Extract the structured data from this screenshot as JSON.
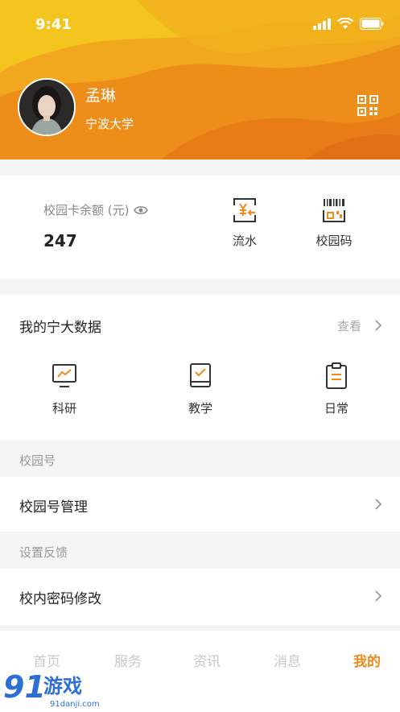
{
  "status": {
    "time": "9:41"
  },
  "profile": {
    "name": "孟琳",
    "school": "宁波大学"
  },
  "card": {
    "balance_label": "校园卡余额 (元)",
    "balance_value": "247",
    "actions": [
      {
        "label": "流水",
        "icon": "yen-transfer-icon"
      },
      {
        "label": "校园码",
        "icon": "barcode-icon"
      }
    ]
  },
  "data_section": {
    "title": "我的宁大数据",
    "more_label": "查看",
    "items": [
      {
        "label": "科研",
        "icon": "chart-monitor-icon"
      },
      {
        "label": "教学",
        "icon": "book-check-icon"
      },
      {
        "label": "日常",
        "icon": "clipboard-icon"
      }
    ]
  },
  "campus": {
    "section_label": "校园号",
    "manage_label": "校园号管理"
  },
  "settings": {
    "section_label": "设置反馈",
    "password_label": "校内密码修改"
  },
  "tabs": [
    "首页",
    "服务",
    "资讯",
    "消息",
    "我的"
  ],
  "active_tab": "我的",
  "watermark": {
    "text": "91游戏",
    "sub": "91danji.com"
  },
  "colors": {
    "accent": "#f08a1a",
    "header_orange": "#f29a1c",
    "header_yellow": "#f4c11f"
  }
}
